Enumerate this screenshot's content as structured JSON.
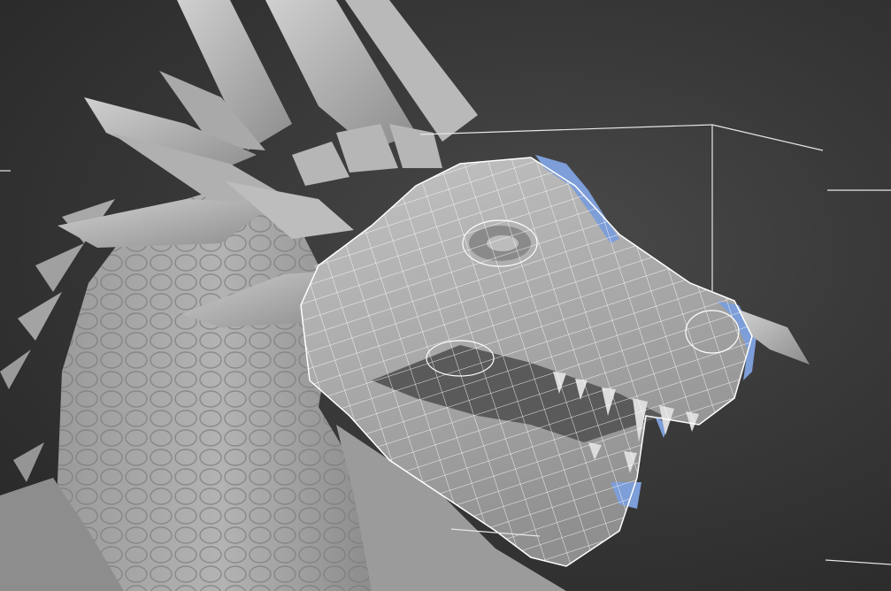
{
  "viewport": {
    "render_mode": "shaded-with-wireframe-overlay",
    "subject": "dragon-head-sculpt",
    "colors": {
      "background_top": "#1f1f1f",
      "background_center": "#4a4a4a",
      "sculpt_surface": "#a9a9a9",
      "sculpt_shadow": "#6f6f6f",
      "sculpt_highlight": "#d2d2d2",
      "wireframe": "#ffffff",
      "selected_faces": "#7d9ed8",
      "bounding_lines": "#e6e6e6"
    }
  }
}
